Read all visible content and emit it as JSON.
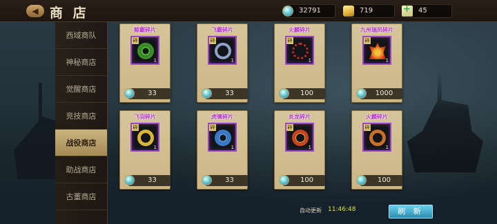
{
  "header": {
    "back_icon": "back-arrow-icon",
    "title": "商 店"
  },
  "currencies": {
    "diamond": {
      "icon": "diamond-icon",
      "value": "32791"
    },
    "gold": {
      "icon": "gold-ingot-icon",
      "value": "719"
    },
    "stamina": {
      "icon": "stamina-scroll-icon",
      "value": "45"
    }
  },
  "sidebar": {
    "items": [
      {
        "label": "西域商队"
      },
      {
        "label": "神秘商店"
      },
      {
        "label": "觉醒商店"
      },
      {
        "label": "竞技商店"
      },
      {
        "label": "战役商店"
      },
      {
        "label": "助战商店"
      },
      {
        "label": "古董商店"
      }
    ],
    "active_index": 4
  },
  "items": [
    {
      "name": "鲸霸碎片",
      "qty": "1",
      "tag": "碎",
      "price": "33",
      "icon": "jade-bead-ring-icon",
      "color": "#3b8f2a"
    },
    {
      "name": "飞霸碎片",
      "qty": "1",
      "tag": "碎",
      "price": "33",
      "icon": "silver-bangle-icon",
      "color": "#8fa3c8"
    },
    {
      "name": "火麟碎片",
      "qty": "1",
      "tag": "碎",
      "price": "100",
      "icon": "red-bead-necklace-icon",
      "color": "#c22a2a"
    },
    {
      "name": "九州瑞凤碎片",
      "qty": "1",
      "tag": "碎",
      "price": "1000",
      "icon": "phoenix-crown-icon",
      "color": "#d54a18"
    },
    {
      "name": "飞羽碎片",
      "qty": "1",
      "tag": "碎",
      "price": "33",
      "icon": "gold-ring-icon",
      "color": "#d9b53a"
    },
    {
      "name": "虎啸碎片",
      "qty": "1",
      "tag": "碎",
      "price": "33",
      "icon": "blue-dragon-ring-icon",
      "color": "#3b78c8"
    },
    {
      "name": "炎龙碎片",
      "qty": "1",
      "tag": "碎",
      "price": "100",
      "icon": "fire-dragon-bracelet-icon",
      "color": "#c8431e"
    },
    {
      "name": "火麟碎片",
      "qty": "1",
      "tag": "碎",
      "price": "100",
      "icon": "copper-ring-icon",
      "color": "#c8702a"
    }
  ],
  "footer": {
    "auto_refresh_label": "自动更新",
    "auto_refresh_time": "11:46:48",
    "refresh_button": "刷 新"
  }
}
